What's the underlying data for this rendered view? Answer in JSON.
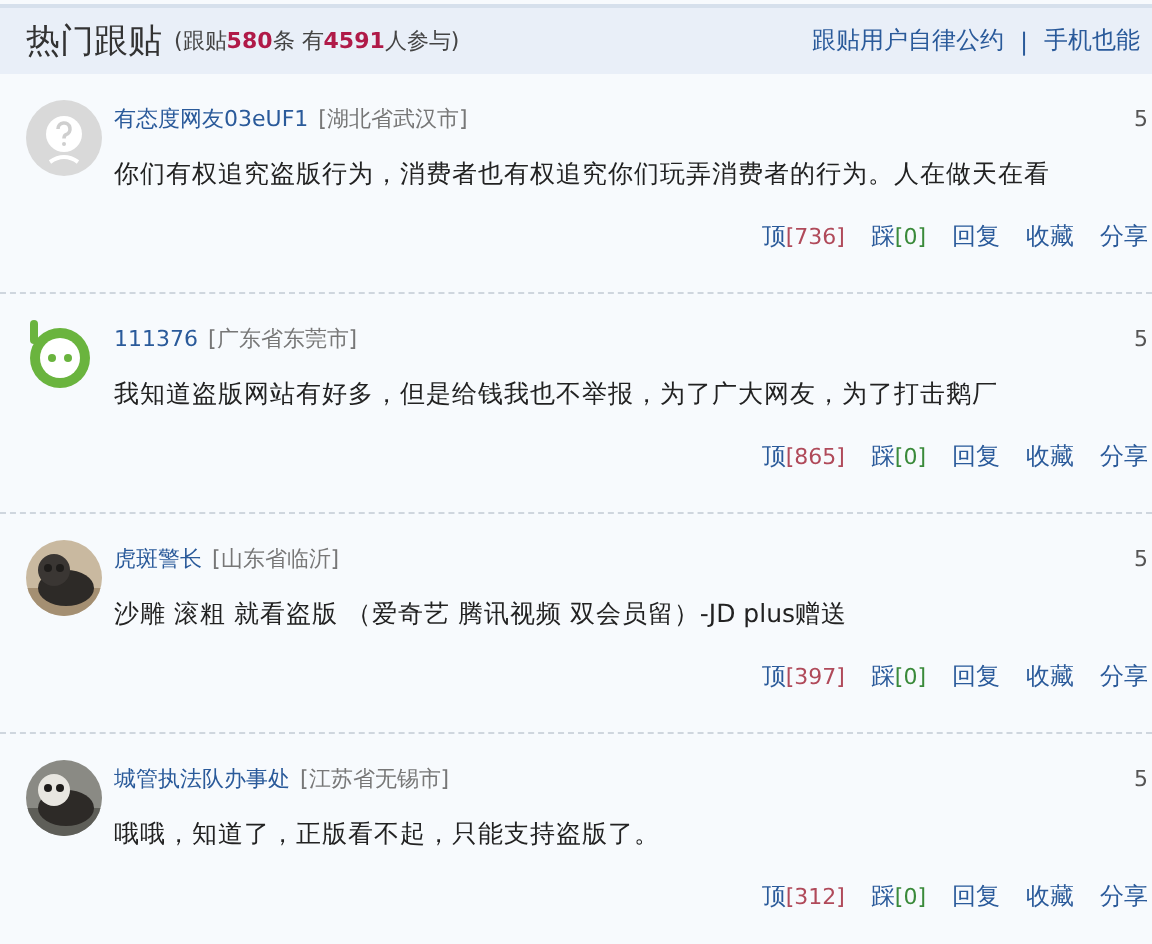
{
  "header": {
    "title": "热门跟贴",
    "summary": [
      {
        "kind": "text",
        "text": "(跟贴"
      },
      {
        "kind": "number",
        "text": "580"
      },
      {
        "kind": "text",
        "text": "条 有"
      },
      {
        "kind": "number",
        "text": "4591"
      },
      {
        "kind": "text",
        "text": "人参与)"
      }
    ],
    "links": [
      "跟贴用户自律公约",
      "手机也能"
    ],
    "separator": "|"
  },
  "comments": [
    {
      "avatar": {
        "kind": "default"
      },
      "user": "有态度网友03eUF1",
      "location": "[湖北省武汉市]",
      "time": "5",
      "text": "你们有权追究盗版行为，消费者也有权追究你们玩弄消费者的行为。人在做天在看",
      "up": "顶",
      "up_count": "[736]",
      "down": "踩",
      "down_count": "[0]",
      "actions": [
        "回复",
        "收藏",
        "分享"
      ]
    },
    {
      "avatar": {
        "kind": "logo"
      },
      "user": "111376",
      "location": "[广东省东莞市]",
      "time": "5",
      "text": "我知道盗版网站有好多，但是给钱我也不举报，为了广大网友，为了打击鹅厂",
      "up": "顶",
      "up_count": "[865]",
      "down": "踩",
      "down_count": "[0]",
      "actions": [
        "回复",
        "收藏",
        "分享"
      ]
    },
    {
      "avatar": {
        "kind": "picture"
      },
      "user": "虎斑警长",
      "location": "[山东省临沂]",
      "time": "5",
      "text": "沙雕 滚粗 就看盗版 （爱奇艺 腾讯视频 双会员留）-JD plus赠送",
      "up": "顶",
      "up_count": "[397]",
      "down": "踩",
      "down_count": "[0]",
      "actions": [
        "回复",
        "收藏",
        "分享"
      ]
    },
    {
      "avatar": {
        "kind": "picture"
      },
      "user": "城管执法队办事处",
      "location": "[江苏省无锡市]",
      "time": "5",
      "text": "哦哦，知道了，正版看不起，只能支持盗版了。",
      "up": "顶",
      "up_count": "[312]",
      "down": "踩",
      "down_count": "[0]",
      "actions": [
        "回复",
        "收藏",
        "分享"
      ]
    }
  ]
}
